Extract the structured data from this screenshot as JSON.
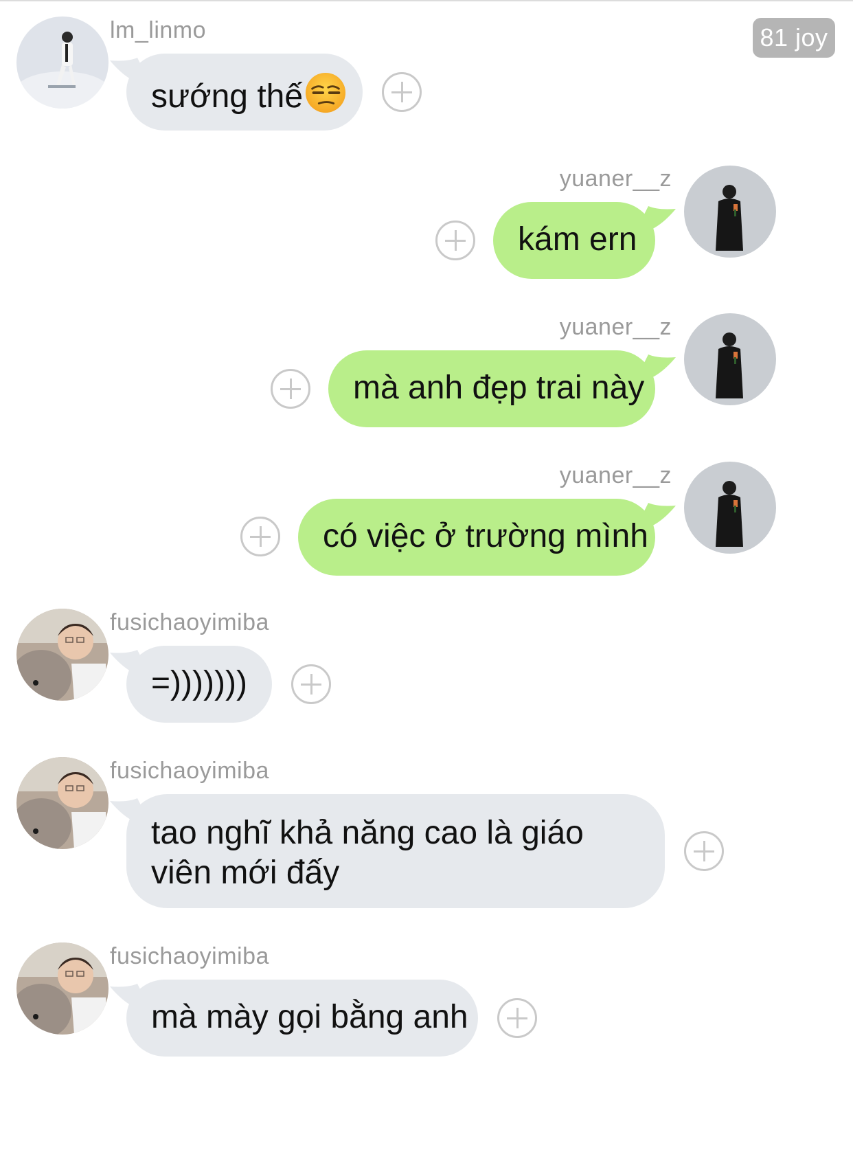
{
  "header": {
    "badge": "81 joy"
  },
  "colors": {
    "incoming_bubble": "#e6e9ed",
    "outgoing_bubble": "#b9ee8a",
    "username": "#9a9a9a"
  },
  "messages": [
    {
      "sender": "lm_linmo",
      "text": "sướng thế",
      "emoji": "unamused-face-emoji",
      "side": "left"
    },
    {
      "sender": "yuaner__z",
      "text": "kám ern",
      "side": "right"
    },
    {
      "sender": "yuaner__z",
      "text": "mà anh đẹp trai này",
      "side": "right"
    },
    {
      "sender": "yuaner__z",
      "text": "có việc ở trường mình",
      "side": "right"
    },
    {
      "sender": "fusichaoyimiba",
      "text": "=)))))))",
      "side": "left"
    },
    {
      "sender": "fusichaoyimiba",
      "text": "tao nghĩ khả năng cao là giáo viên mới đấy",
      "side": "left"
    },
    {
      "sender": "fusichaoyimiba",
      "text": "mà mày gọi bằng anh",
      "side": "left"
    }
  ]
}
